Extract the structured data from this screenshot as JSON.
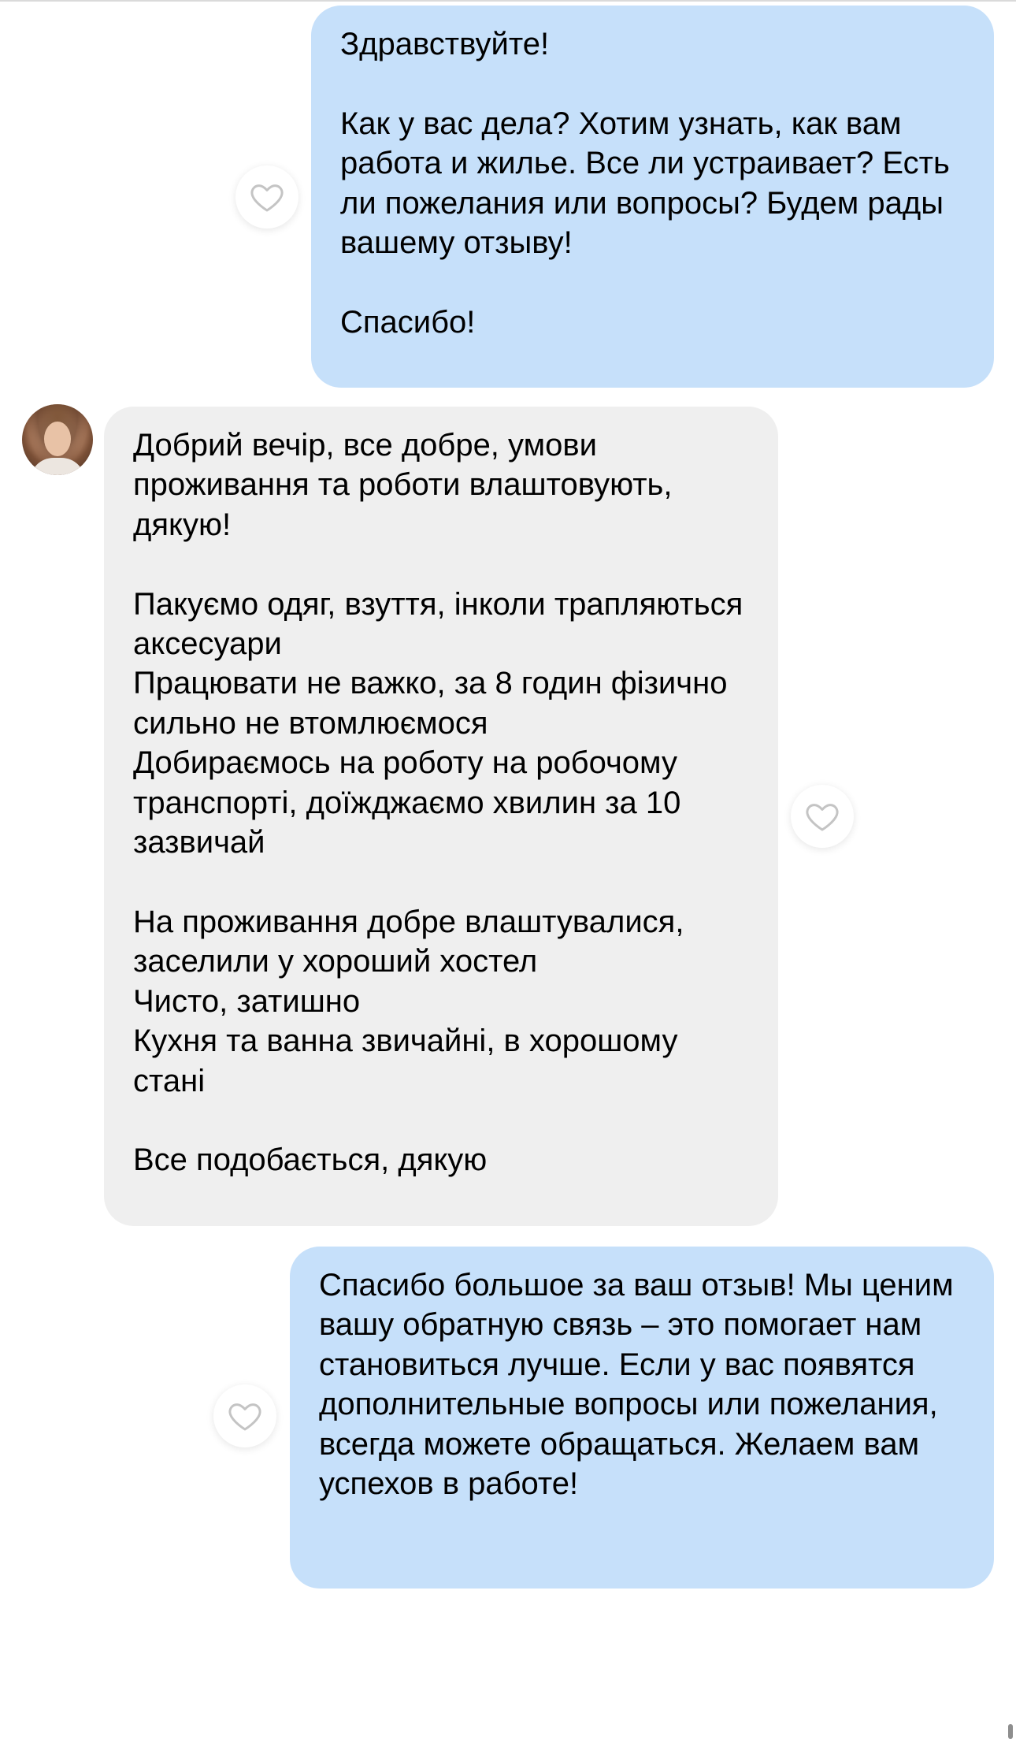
{
  "conversation": {
    "messages": [
      {
        "sender": "me",
        "text": "Здравствуйте!\n\nКак у вас дела? Хотим узнать, как вам работа и жилье. Все ли устраивает? Есть ли пожелания или вопросы? Будем рады вашему отзыву!\n\nСпасибо!",
        "liked": false
      },
      {
        "sender": "contact",
        "text": "Добрий вечір, все добре, умови проживання та роботи влаштовують, дякую!\n\nПакуємо одяг, взуття, інколи трапляються аксесуари\nПрацювати не важко, за 8 годин фізично сильно не втомлюємося\nДобираємось на роботу на робочому транспорті, доїжджаємо хвилин за 10 зазвичай\n\nНа проживання добре влаштувалися, заселили у хороший хостел\nЧисто, затишно\nКухня та ванна звичайні, в хорошому стані\n\nВсе подобається, дякую",
        "liked": false
      },
      {
        "sender": "me",
        "text": "Спасибо большое за ваш отзыв! Мы ценим вашу обратную связь – это помогает нам становиться лучше. Если у вас появятся дополнительные вопросы или пожелания, всегда можете обращаться. Желаем вам успехов в работе!",
        "liked": false
      }
    ]
  },
  "colors": {
    "outgoing_bubble": "#c6e0fa",
    "incoming_bubble": "#efefef",
    "like_icon": "#c4c4c4"
  },
  "icons": {
    "like": "heart-outline-icon"
  }
}
